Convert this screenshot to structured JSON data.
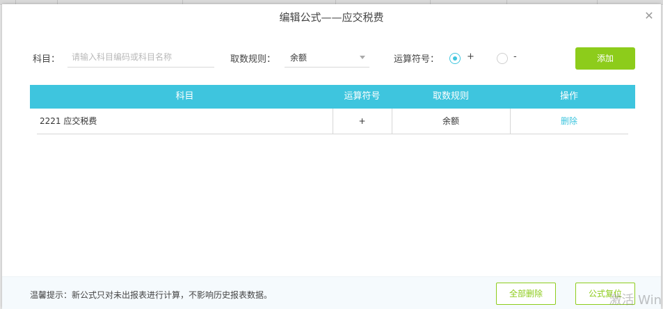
{
  "dialog": {
    "title": "编辑公式——应交税费",
    "close_icon": "close-icon"
  },
  "form": {
    "subject_label": "科目：",
    "subject_placeholder": "请输入科目编码或科目名称",
    "subject_value": "",
    "rule_label": "取数规则：",
    "rule_value": "余额",
    "operator_label": "运算符号：",
    "operator_options": [
      {
        "label": "+",
        "selected": true
      },
      {
        "label": "-",
        "selected": false
      }
    ],
    "add_button": "添加"
  },
  "table": {
    "headers": [
      "科目",
      "运算符号",
      "取数规则",
      "操作"
    ],
    "rows": [
      {
        "subject": "2221 应交税费",
        "operator": "+",
        "rule": "余额",
        "action": "删除"
      }
    ]
  },
  "footer": {
    "tip": "温馨提示：新公式只对未出报表进行计算，不影响历史报表数据。",
    "delete_all_button": "全部删除",
    "reset_button": "公式复位"
  },
  "watermark": "激活 Win",
  "colors": {
    "accent": "#3ec5de",
    "green": "#8dcc1b"
  }
}
